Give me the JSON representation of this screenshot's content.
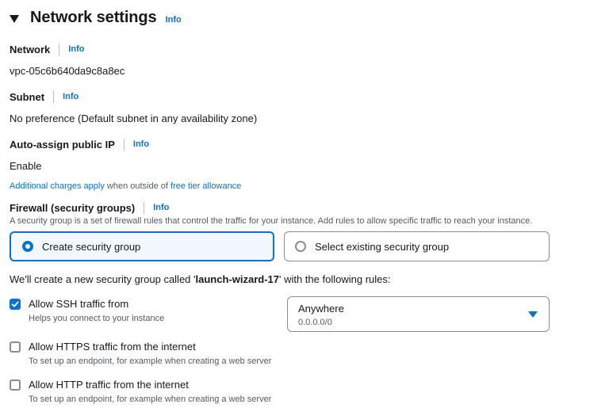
{
  "section": {
    "title": "Network settings",
    "info": "Info"
  },
  "network": {
    "label": "Network",
    "info": "Info",
    "value": "vpc-05c6b640da9c8a8ec"
  },
  "subnet": {
    "label": "Subnet",
    "info": "Info",
    "value": "No preference (Default subnet in any availability zone)"
  },
  "public_ip": {
    "label": "Auto-assign public IP",
    "info": "Info",
    "value": "Enable",
    "note": {
      "link1": "Additional charges apply",
      "middle": " when outside of ",
      "link2": "free tier allowance"
    }
  },
  "firewall": {
    "label": "Firewall (security groups)",
    "info": "Info",
    "description": "A security group is a set of firewall rules that control the traffic for your instance. Add rules to allow specific traffic to reach your instance.",
    "options": [
      {
        "label": "Create security group",
        "selected": true
      },
      {
        "label": "Select existing security group",
        "selected": false
      }
    ],
    "summary": {
      "prefix": "We'll create a new security group called '",
      "name": "launch-wizard-17",
      "suffix": "' with the following rules:"
    }
  },
  "rules": [
    {
      "label": "Allow SSH traffic from",
      "description": "Helps you connect to your instance",
      "checked": true
    },
    {
      "label": "Allow HTTPS traffic from the internet",
      "description": "To set up an endpoint, for example when creating a web server",
      "checked": false
    },
    {
      "label": "Allow HTTP traffic from the internet",
      "description": "To set up an endpoint, for example when creating a web server",
      "checked": false
    }
  ],
  "ssh_source": {
    "value": "Anywhere",
    "detail": "0.0.0.0/0"
  },
  "icons": {
    "caret": "caret-down-icon",
    "check": "check-icon",
    "select_arrow": "select-arrow-icon"
  },
  "colors": {
    "accent": "#0972d3",
    "text": "#16191f",
    "muted": "#545b64",
    "border": "#8c8c94"
  }
}
